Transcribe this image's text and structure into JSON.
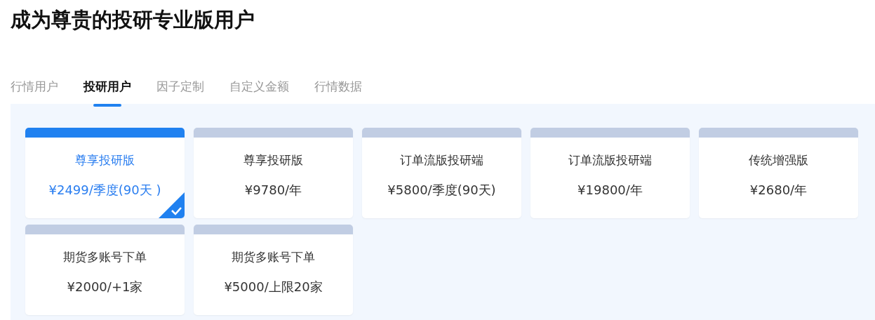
{
  "title": "成为尊贵的投研专业版用户",
  "tabs": [
    {
      "label": "行情用户",
      "selected": false
    },
    {
      "label": "投研用户",
      "selected": true
    },
    {
      "label": "因子定制",
      "selected": false
    },
    {
      "label": "自定义金额",
      "selected": false
    },
    {
      "label": "行情数据",
      "selected": false
    }
  ],
  "plans": [
    {
      "name": "尊享投研版",
      "price": "¥2499/季度(90天 )",
      "selected": true
    },
    {
      "name": "尊享投研版",
      "price": "¥9780/年",
      "selected": false
    },
    {
      "name": "订单流版投研端",
      "price": "¥5800/季度(90天)",
      "selected": false
    },
    {
      "name": "订单流版投研端",
      "price": "¥19800/年",
      "selected": false
    },
    {
      "name": "传统增强版",
      "price": "¥2680/年",
      "selected": false
    },
    {
      "name": "期货多账号下单",
      "price": "¥2000/+1家",
      "selected": false
    },
    {
      "name": "期货多账号下单",
      "price": "¥5000/上限20家",
      "selected": false
    }
  ]
}
